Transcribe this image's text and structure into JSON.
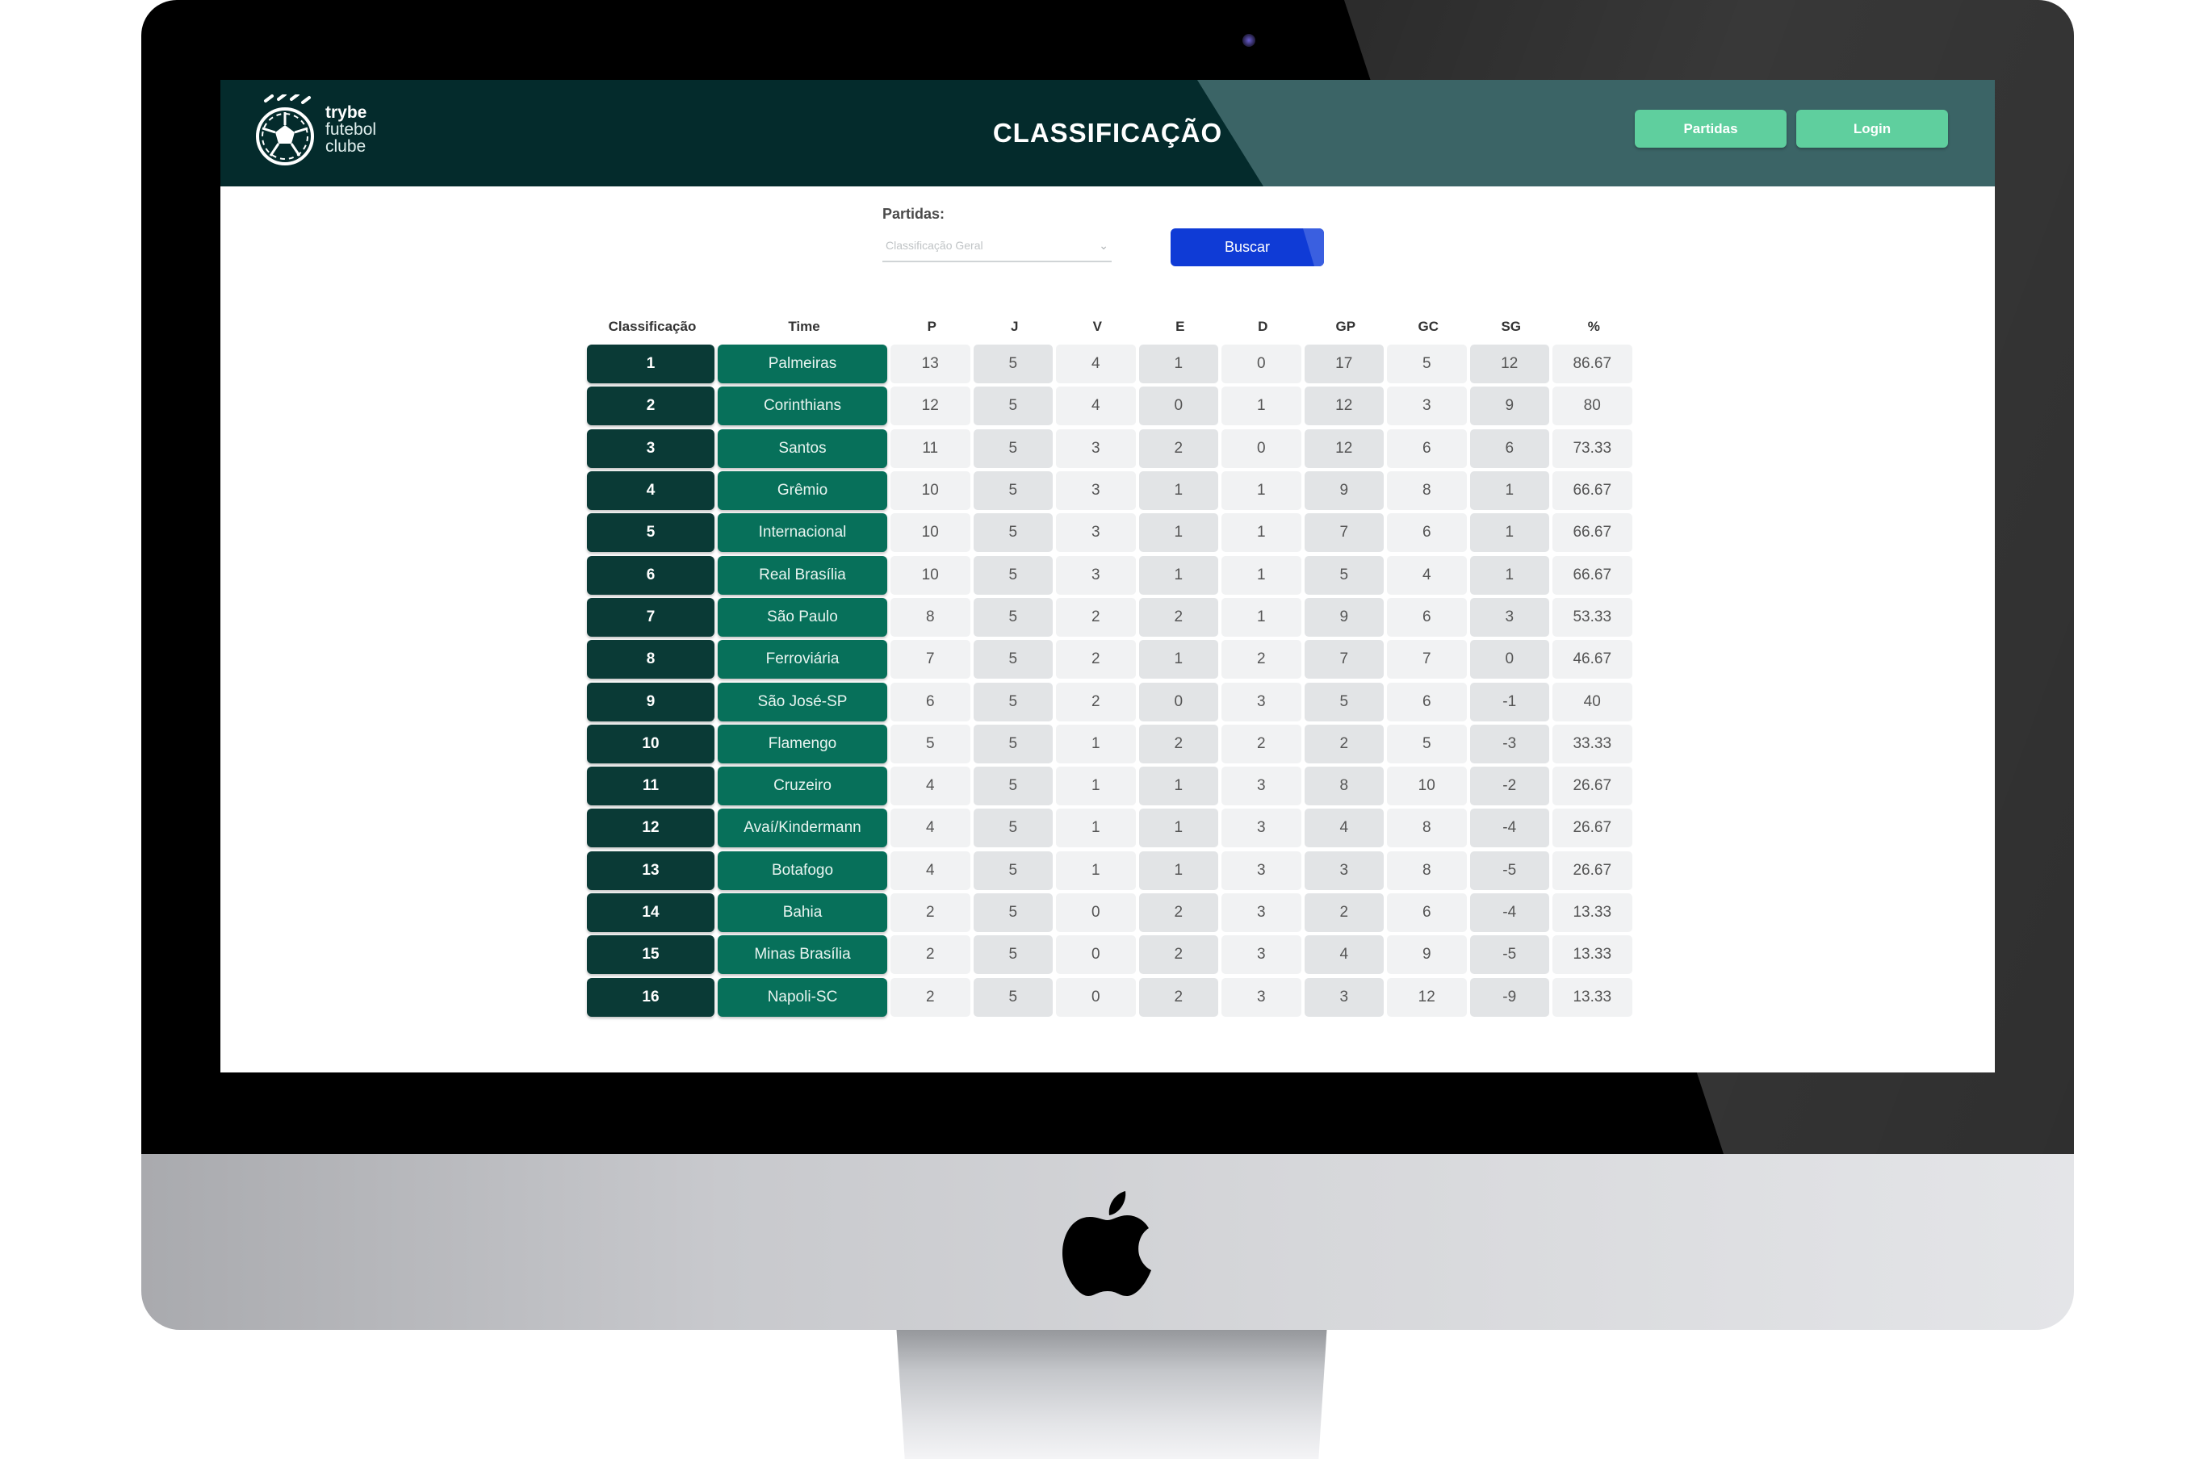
{
  "header": {
    "logo_lines": [
      "trybe",
      "futebol",
      "clube"
    ],
    "title": "CLASSIFICAÇÃO",
    "nav": {
      "matches_label": "Partidas",
      "login_label": "Login"
    }
  },
  "filter": {
    "label": "Partidas:",
    "selected": "Classificação Geral",
    "search_label": "Buscar"
  },
  "leaderboard": {
    "columns": [
      "Classificação",
      "Time",
      "P",
      "J",
      "V",
      "E",
      "D",
      "GP",
      "GC",
      "SG",
      "%"
    ],
    "rows": [
      [
        "1",
        "Palmeiras",
        "13",
        "5",
        "4",
        "1",
        "0",
        "17",
        "5",
        "12",
        "86.67"
      ],
      [
        "2",
        "Corinthians",
        "12",
        "5",
        "4",
        "0",
        "1",
        "12",
        "3",
        "9",
        "80"
      ],
      [
        "3",
        "Santos",
        "11",
        "5",
        "3",
        "2",
        "0",
        "12",
        "6",
        "6",
        "73.33"
      ],
      [
        "4",
        "Grêmio",
        "10",
        "5",
        "3",
        "1",
        "1",
        "9",
        "8",
        "1",
        "66.67"
      ],
      [
        "5",
        "Internacional",
        "10",
        "5",
        "3",
        "1",
        "1",
        "7",
        "6",
        "1",
        "66.67"
      ],
      [
        "6",
        "Real Brasília",
        "10",
        "5",
        "3",
        "1",
        "1",
        "5",
        "4",
        "1",
        "66.67"
      ],
      [
        "7",
        "São Paulo",
        "8",
        "5",
        "2",
        "2",
        "1",
        "9",
        "6",
        "3",
        "53.33"
      ],
      [
        "8",
        "Ferroviária",
        "7",
        "5",
        "2",
        "1",
        "2",
        "7",
        "7",
        "0",
        "46.67"
      ],
      [
        "9",
        "São José-SP",
        "6",
        "5",
        "2",
        "0",
        "3",
        "5",
        "6",
        "-1",
        "40"
      ],
      [
        "10",
        "Flamengo",
        "5",
        "5",
        "1",
        "2",
        "2",
        "2",
        "5",
        "-3",
        "33.33"
      ],
      [
        "11",
        "Cruzeiro",
        "4",
        "5",
        "1",
        "1",
        "3",
        "8",
        "10",
        "-2",
        "26.67"
      ],
      [
        "12",
        "Avaí/Kindermann",
        "4",
        "5",
        "1",
        "1",
        "3",
        "4",
        "8",
        "-4",
        "26.67"
      ],
      [
        "13",
        "Botafogo",
        "4",
        "5",
        "1",
        "1",
        "3",
        "3",
        "8",
        "-5",
        "26.67"
      ],
      [
        "14",
        "Bahia",
        "2",
        "5",
        "0",
        "2",
        "3",
        "2",
        "6",
        "-4",
        "13.33"
      ],
      [
        "15",
        "Minas Brasília",
        "2",
        "5",
        "0",
        "2",
        "3",
        "4",
        "9",
        "-5",
        "13.33"
      ],
      [
        "16",
        "Napoli-SC",
        "2",
        "5",
        "0",
        "2",
        "3",
        "3",
        "12",
        "-9",
        "13.33"
      ]
    ]
  },
  "colors": {
    "header_bg": "#042b2c",
    "header_sheen": "#3b6466",
    "nav_button": "#5fcf9e",
    "search_button": "#0f3bd6",
    "rank_cell": "#0a3a36",
    "team_cell": "#07705a"
  },
  "icons": {
    "logo": "soccer-ball-logo",
    "select_chevron": "chevron-down-icon",
    "device_logo": "apple-logo"
  }
}
